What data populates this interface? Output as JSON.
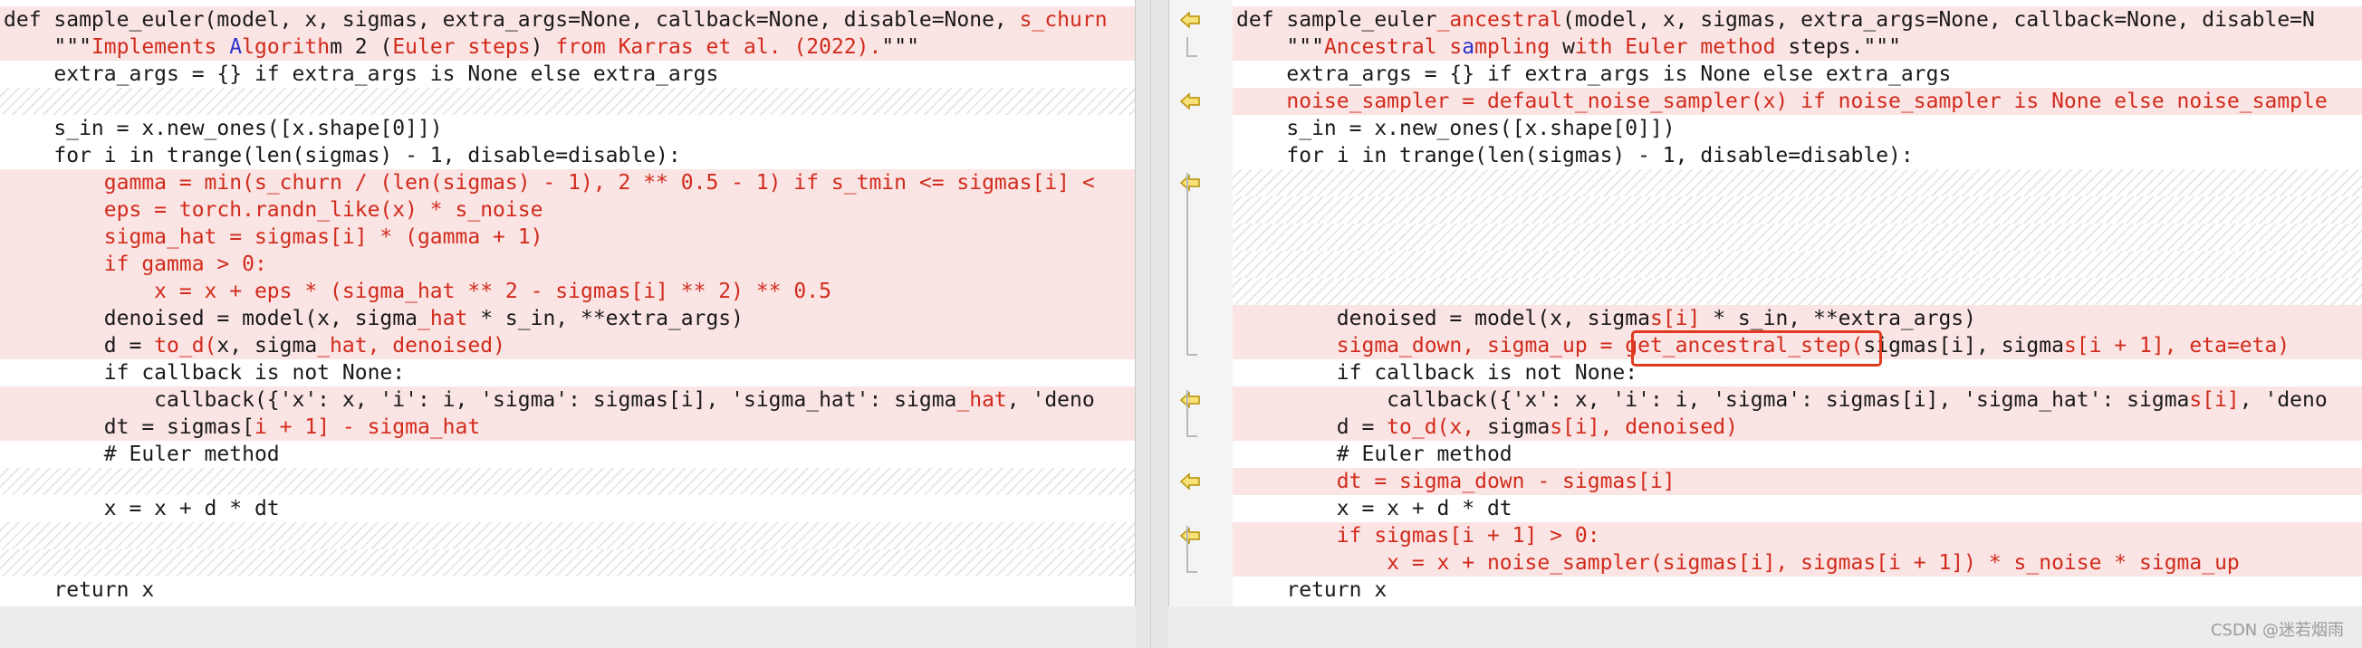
{
  "left": {
    "lines": [
      {
        "type": "changed",
        "parts": [
          {
            "t": "def sample_euler(model, x, sigmas, extra_args=None, callback=None, disable=None, "
          },
          {
            "t": "s_churn",
            "c": "r"
          }
        ]
      },
      {
        "type": "changed",
        "parts": [
          {
            "t": "    \"\"\""
          },
          {
            "t": "Implements ",
            "c": "r"
          },
          {
            "t": "A",
            "c": "b"
          },
          {
            "t": "lgorith",
            "c": "r"
          },
          {
            "t": "m 2 ("
          },
          {
            "t": "Euler steps",
            "c": "r"
          },
          {
            "t": ") "
          },
          {
            "t": "from Karras et al. (2022).",
            "c": "r"
          },
          {
            "t": "\"\"\""
          }
        ]
      },
      {
        "type": "normal",
        "parts": [
          {
            "t": "    extra_args = {} if extra_args is None else extra_args"
          }
        ]
      },
      {
        "type": "filler",
        "parts": []
      },
      {
        "type": "normal",
        "parts": [
          {
            "t": "    s_in = x.new_ones([x.shape[0]])"
          }
        ]
      },
      {
        "type": "normal",
        "parts": [
          {
            "t": "    for i in trange(len(sigmas) - 1, disable=disable):"
          }
        ]
      },
      {
        "type": "changed",
        "parts": [
          {
            "t": "        gamma = min(s_churn / (len(sigmas) - 1), 2 ** 0.5 - 1) if s_tmin <= sigmas[i] <",
            "c": "r"
          }
        ]
      },
      {
        "type": "changed",
        "parts": [
          {
            "t": "        eps = torch.randn_like(x) * s_noise",
            "c": "r"
          }
        ]
      },
      {
        "type": "changed",
        "parts": [
          {
            "t": "        sigma_hat = sigmas[i] * (gamma + 1)",
            "c": "r"
          }
        ]
      },
      {
        "type": "changed",
        "parts": [
          {
            "t": "        if gamma > 0:",
            "c": "r"
          }
        ]
      },
      {
        "type": "changed",
        "parts": [
          {
            "t": "            x = x + eps * (sigma_hat ** 2 - sigmas[i] ** 2) ** 0.5",
            "c": "r"
          }
        ]
      },
      {
        "type": "changed",
        "parts": [
          {
            "t": "        denoised = model(x, sigma"
          },
          {
            "t": "_hat",
            "c": "r"
          },
          {
            "t": " * s_in, **extra_args)"
          }
        ]
      },
      {
        "type": "changed",
        "parts": [
          {
            "t": "        d = "
          },
          {
            "t": "to_d(",
            "c": "r"
          },
          {
            "t": "x, sigma"
          },
          {
            "t": "_hat",
            "c": "r"
          },
          {
            "t": ", denoised)",
            "c": "r"
          }
        ]
      },
      {
        "type": "normal",
        "parts": [
          {
            "t": "        if callback is not None:"
          }
        ]
      },
      {
        "type": "changed",
        "parts": [
          {
            "t": "            callback({'x': x, 'i': i, 'sigma': sigmas[i], 'sigma_hat': sigma"
          },
          {
            "t": "_hat",
            "c": "r"
          },
          {
            "t": ", 'deno"
          }
        ]
      },
      {
        "type": "changed",
        "parts": [
          {
            "t": "        dt = sigmas["
          },
          {
            "t": "i + 1] - sigma_hat",
            "c": "r"
          }
        ]
      },
      {
        "type": "normal",
        "parts": [
          {
            "t": "        # Euler method"
          }
        ]
      },
      {
        "type": "filler",
        "parts": []
      },
      {
        "type": "normal",
        "parts": [
          {
            "t": "        x = x + d * dt"
          }
        ]
      },
      {
        "type": "filler",
        "parts": []
      },
      {
        "type": "filler",
        "parts": []
      },
      {
        "type": "normal",
        "parts": [
          {
            "t": "    return x"
          }
        ]
      }
    ]
  },
  "right": {
    "lines": [
      {
        "type": "changed",
        "parts": [
          {
            "t": "def sample_euler"
          },
          {
            "t": "_ancestral",
            "c": "r"
          },
          {
            "t": "(model, x, sigmas, extra_args=None, callback=None, disable=N"
          }
        ]
      },
      {
        "type": "changed",
        "parts": [
          {
            "t": "    \"\"\""
          },
          {
            "t": "Ancestral s",
            "c": "r"
          },
          {
            "t": "a",
            "c": "b"
          },
          {
            "t": "mpling ",
            "c": "r"
          },
          {
            "t": "w"
          },
          {
            "t": "ith Euler ",
            "c": "r"
          },
          {
            "t": "method",
            "c": "r"
          },
          {
            "t": " steps."
          },
          {
            "t": "\"\"\""
          }
        ]
      },
      {
        "type": "normal",
        "parts": [
          {
            "t": "    extra_args = {} if extra_args is None else extra_args"
          }
        ]
      },
      {
        "type": "changed",
        "parts": [
          {
            "t": "    noise_sampler = default_noise_sampler(x) if noise_sampler is None else noise_sample",
            "c": "r"
          }
        ]
      },
      {
        "type": "normal",
        "parts": [
          {
            "t": "    s_in = x.new_ones([x.shape[0]])"
          }
        ]
      },
      {
        "type": "normal",
        "parts": [
          {
            "t": "    for i in trange(len(sigmas) - 1, disable=disable):"
          }
        ]
      },
      {
        "type": "filler",
        "parts": []
      },
      {
        "type": "filler",
        "parts": []
      },
      {
        "type": "filler",
        "parts": []
      },
      {
        "type": "filler",
        "parts": []
      },
      {
        "type": "filler",
        "parts": []
      },
      {
        "type": "changed",
        "parts": [
          {
            "t": "        denoised = model(x, sigma"
          },
          {
            "t": "s[i]",
            "c": "r"
          },
          {
            "t": " * s_in, **extra_args)"
          }
        ]
      },
      {
        "type": "changed",
        "parts": [
          {
            "t": "        sigma_down, sigma_up = ",
            "c": "r"
          },
          {
            "t": "get_ancestral_step(",
            "c": "r"
          },
          {
            "t": "sigmas[i], sigma"
          },
          {
            "t": "s[i + 1], eta=eta)",
            "c": "r"
          }
        ]
      },
      {
        "type": "normal",
        "parts": [
          {
            "t": "        if callback is not None:"
          }
        ]
      },
      {
        "type": "changed",
        "parts": [
          {
            "t": "            callback({'x': x, 'i': i, 'sigma': sigmas[i], 'sigma_hat': sigma"
          },
          {
            "t": "s[i]",
            "c": "r"
          },
          {
            "t": ", 'deno"
          }
        ]
      },
      {
        "type": "changed",
        "parts": [
          {
            "t": "        d = "
          },
          {
            "t": "to_d(x, ",
            "c": "r"
          },
          {
            "t": "sigma"
          },
          {
            "t": "s[i]",
            "c": "r"
          },
          {
            "t": ", denoised)",
            "c": "r"
          }
        ]
      },
      {
        "type": "normal",
        "parts": [
          {
            "t": "        # Euler method"
          }
        ]
      },
      {
        "type": "changed",
        "parts": [
          {
            "t": "        dt = sigma_down - sigmas[i]",
            "c": "r"
          }
        ]
      },
      {
        "type": "normal",
        "parts": [
          {
            "t": "        x = x + d * dt"
          }
        ]
      },
      {
        "type": "changed",
        "parts": [
          {
            "t": "        if sigmas[i + 1] > 0:",
            "c": "r"
          }
        ]
      },
      {
        "type": "changed",
        "parts": [
          {
            "t": "            x = x + noise_sampler(sigmas[i], sigmas[i + 1]) * s_noise * sigma_up",
            "c": "r"
          }
        ]
      },
      {
        "type": "normal",
        "parts": [
          {
            "t": "    return x"
          }
        ]
      }
    ]
  },
  "gutter_marks": [
    0,
    3,
    6,
    14,
    17,
    19
  ],
  "watermark": "CSDN @迷若烟雨",
  "colors": {
    "changed_bg": "#fbe4e4",
    "removed_text": "#d12b1c",
    "accent_blue": "#2b32c8",
    "arrow": "#d7a800",
    "highlight": "#e03a1e"
  }
}
